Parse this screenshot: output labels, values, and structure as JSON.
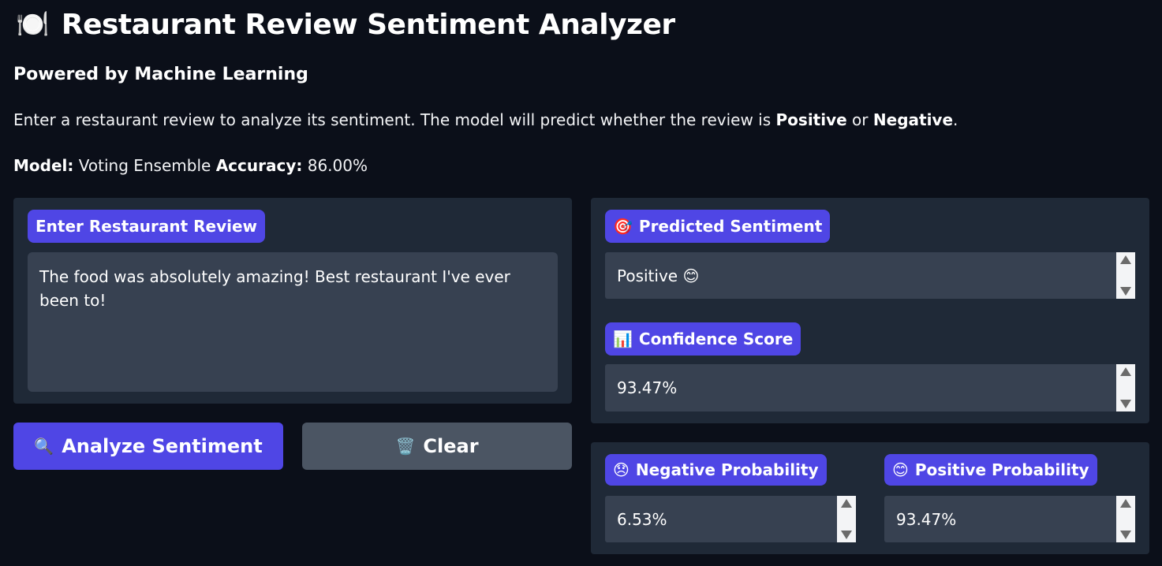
{
  "header": {
    "icon": "plate-cutlery-icon",
    "icon_glyph": "🍽️",
    "title": "Restaurant Review Sentiment Analyzer",
    "subtitle": "Powered by Machine Learning"
  },
  "description": {
    "prefix": "Enter a restaurant review to analyze its sentiment. The model will predict whether the review is ",
    "positive": "Positive",
    "middle": " or ",
    "negative": "Negative",
    "suffix": "."
  },
  "model_info": {
    "model_label": "Model:",
    "model_value": " Voting Ensemble ",
    "accuracy_label": "Accuracy:",
    "accuracy_value": " 86.00%"
  },
  "input": {
    "label": "Enter Restaurant Review",
    "value": "The food was absolutely amazing! Best restaurant I've ever been to!"
  },
  "buttons": {
    "analyze_icon": "🔍",
    "analyze_label": "Analyze Sentiment",
    "clear_icon": "🗑️",
    "clear_label": "Clear"
  },
  "outputs": {
    "sentiment_icon": "🎯",
    "sentiment_label": "Predicted Sentiment",
    "sentiment_value": "Positive 😊",
    "confidence_icon": "📊",
    "confidence_label": "Confidence Score",
    "confidence_value": "93.47%",
    "negative_icon": "😞",
    "negative_label": "Negative Probability",
    "negative_value": "6.53%",
    "positive_icon": "😊",
    "positive_label": "Positive Probability",
    "positive_value": "93.47%"
  },
  "colors": {
    "background": "#0b0f19",
    "panel": "#1f2937",
    "field": "#374151",
    "accent": "#4f46e5",
    "secondary_button": "#4b5563"
  }
}
